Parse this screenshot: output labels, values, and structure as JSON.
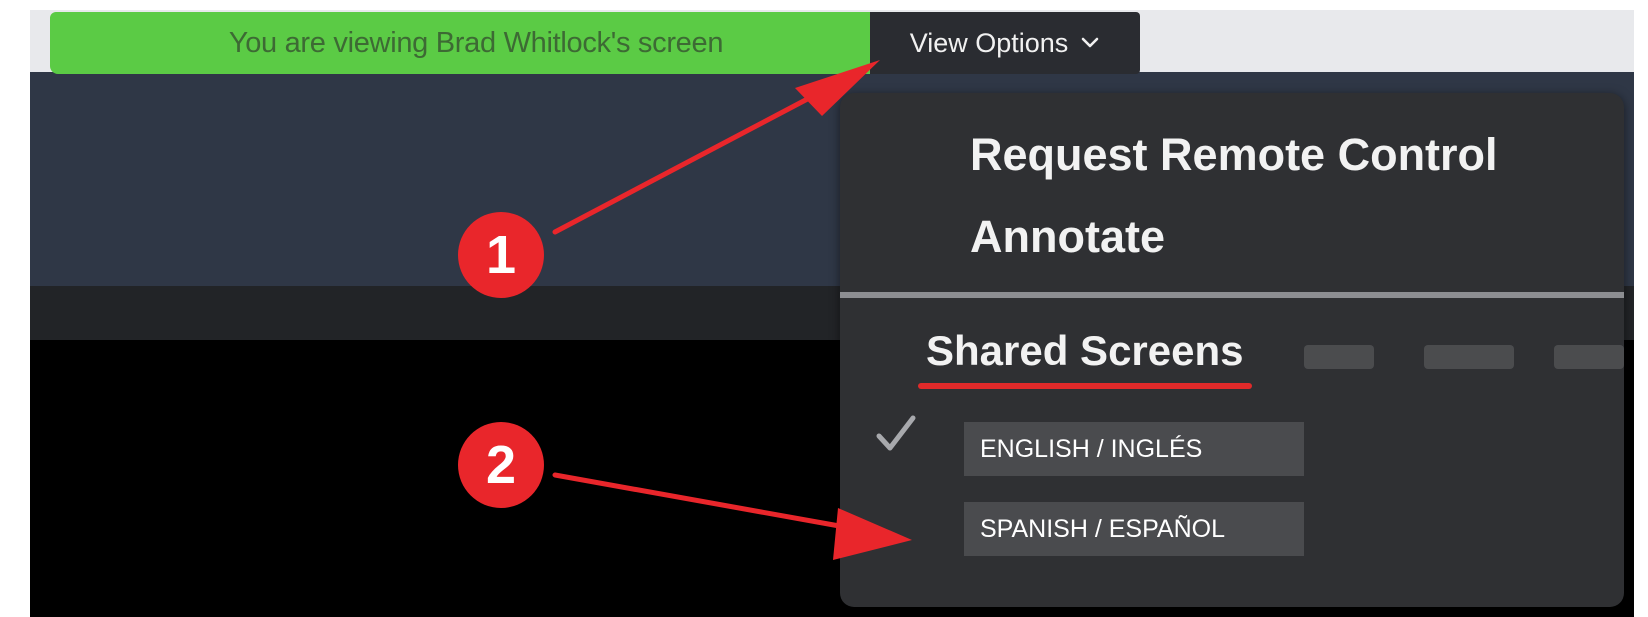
{
  "banner": {
    "viewing_text": "You are viewing Brad Whitlock's screen",
    "view_options_label": "View Options",
    "view_options_icon": "chevron-down-icon"
  },
  "menu": {
    "items": [
      {
        "label": "Request Remote Control"
      },
      {
        "label": "Annotate"
      }
    ],
    "shared_screens_title": "Shared Screens",
    "screens": [
      {
        "label": "ENGLISH / INGLÉS",
        "selected": true
      },
      {
        "label": "SPANISH / ESPAÑOL",
        "selected": false
      }
    ]
  },
  "annotations": {
    "step1": "1",
    "step2": "2",
    "marker_color": "#e9262b"
  },
  "colors": {
    "banner_green": "#5bcb45",
    "menu_bg": "#2f3033",
    "app_navy": "#2f3746"
  }
}
